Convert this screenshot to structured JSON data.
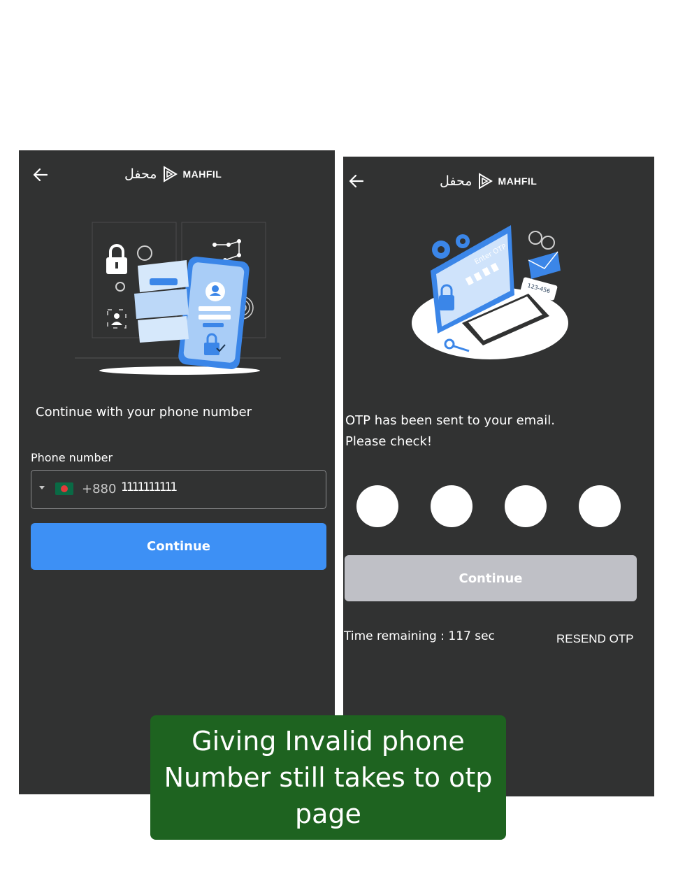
{
  "phone_screen": {
    "brand_arabic": "محفل",
    "brand_latin": "MAHFIL",
    "heading": "Continue with your phone number",
    "phone_label": "Phone number",
    "country_code": "+880",
    "phone_value": "1111111111",
    "continue_label": "Continue",
    "colors": {
      "background": "#313232",
      "accent": "#3d90f5"
    }
  },
  "otp_screen": {
    "brand_arabic": "محفل",
    "brand_latin": "MAHFIL",
    "illustration_title": "Enter OTP",
    "illustration_code": "123-456",
    "message_line1": "OTP has been sent to your email.",
    "message_line2": "Please check!",
    "otp_digits": [
      "",
      "",
      "",
      ""
    ],
    "continue_label": "Continue",
    "timer_text": "Time remaining : 117 sec",
    "resend_label": "RESEND OTP",
    "colors": {
      "disabled_button": "#bfc0c6"
    }
  },
  "caption": {
    "text": "Giving Invalid phone Number still takes to otp page",
    "background": "#1e6320"
  }
}
